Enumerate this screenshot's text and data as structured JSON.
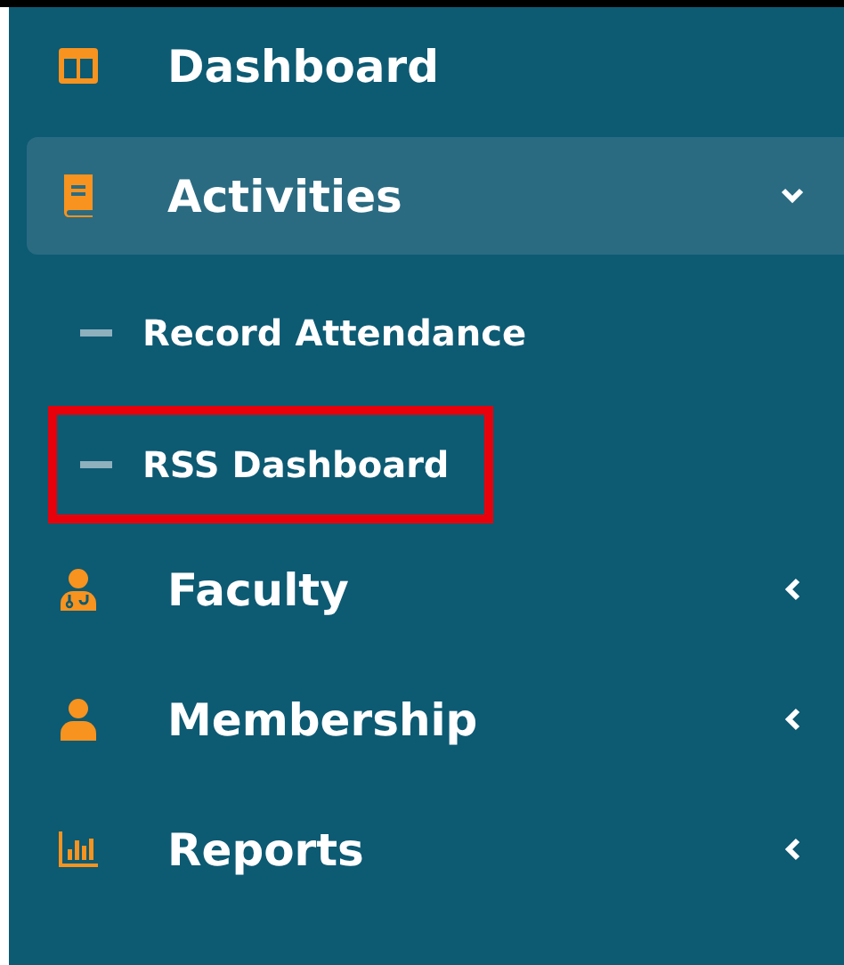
{
  "menu": [
    {
      "label": "Dashboard",
      "active": false
    },
    {
      "label": "Activities",
      "active": true,
      "expanded": true,
      "children": [
        {
          "label": "Record Attendance",
          "outlined": false
        },
        {
          "label": "RSS Dashboard",
          "outlined": true
        }
      ]
    },
    {
      "label": "Faculty",
      "active": false,
      "expanded": false
    },
    {
      "label": "Membership",
      "active": false,
      "expanded": false
    },
    {
      "label": "Reports",
      "active": false,
      "expanded": false
    }
  ]
}
